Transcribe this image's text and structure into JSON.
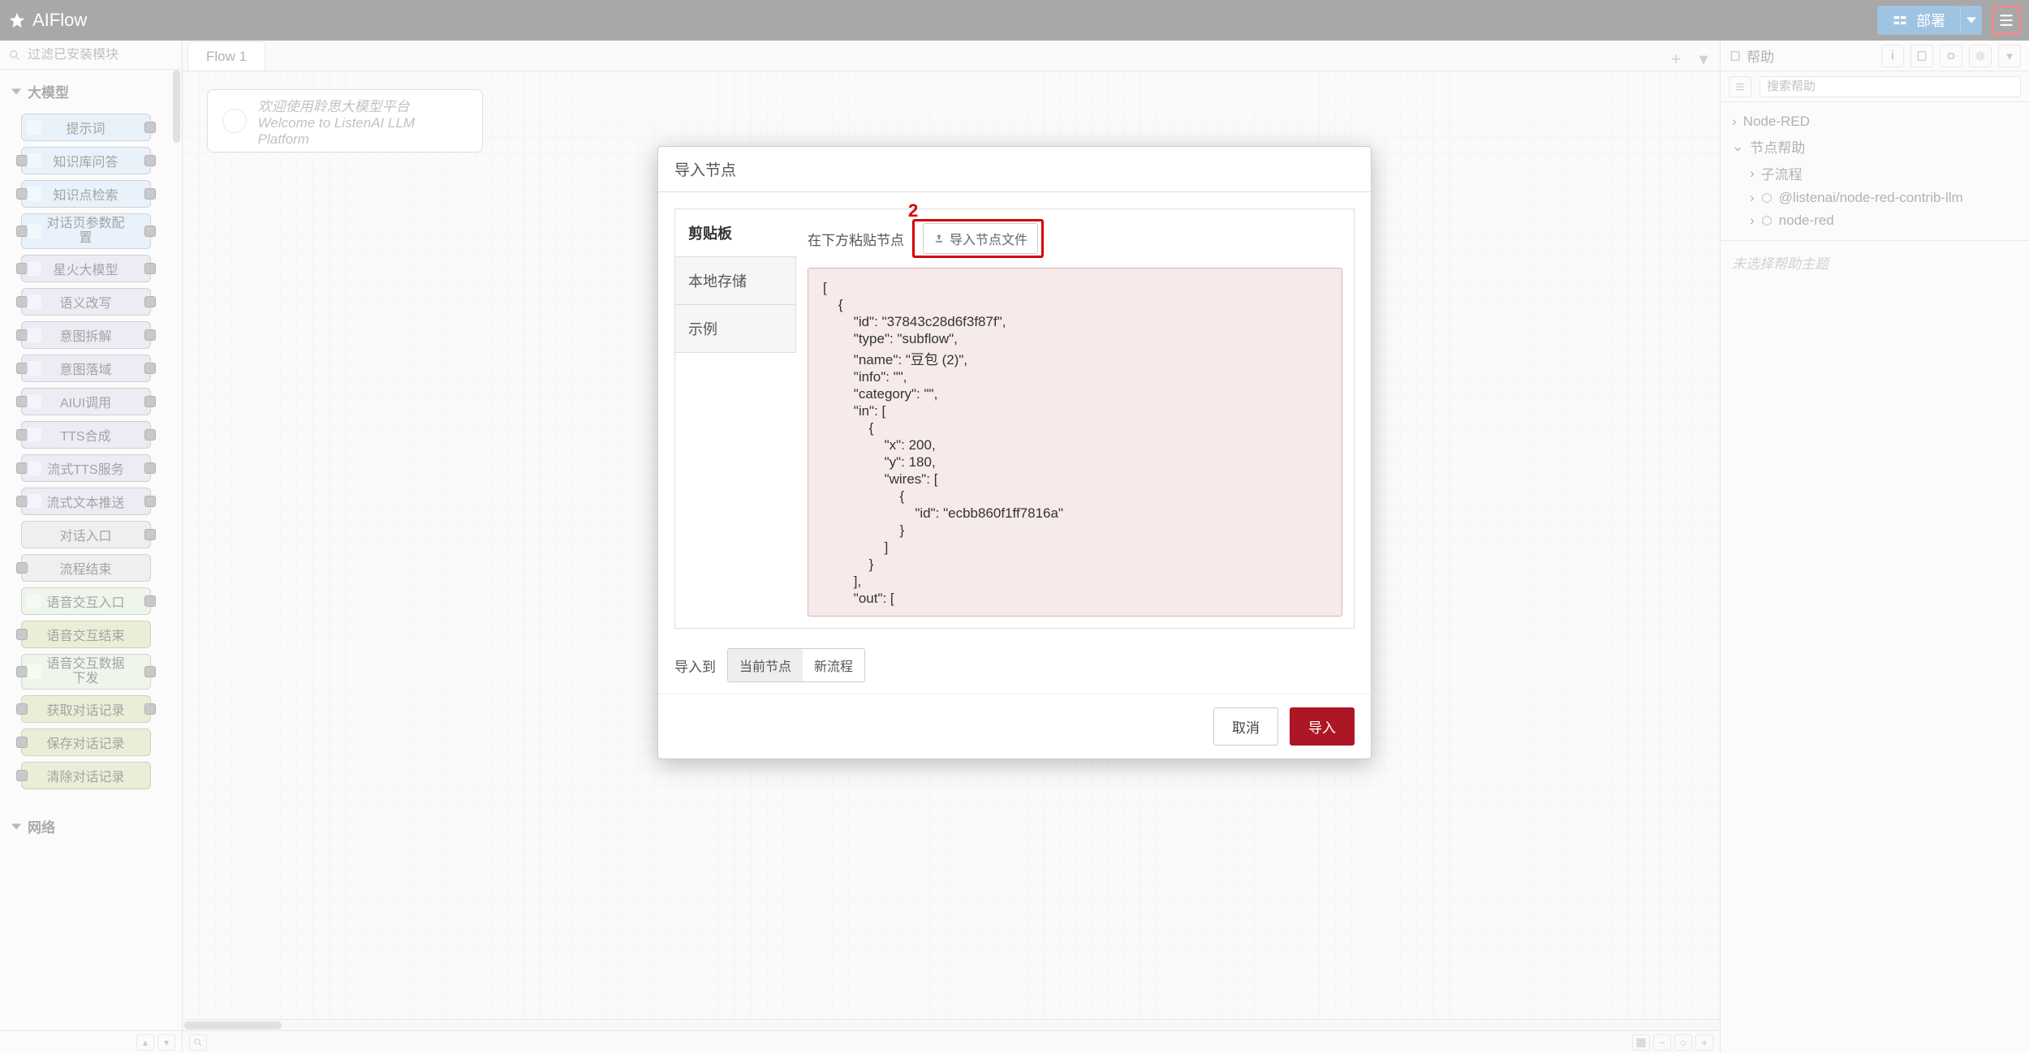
{
  "header": {
    "brand": "AIFlow",
    "deploy_label": "部署"
  },
  "palette": {
    "search_placeholder": "过滤已安装模块",
    "cat1": "大模型",
    "cat2": "网络",
    "nodes": {
      "n0": "提示词",
      "n1": "知识库问答",
      "n2": "知识点检索",
      "n3a": "对话页参数配",
      "n3b": "置",
      "n4": "星火大模型",
      "n5": "语义改写",
      "n6": "意图拆解",
      "n7": "意图落域",
      "n8": "AIUI调用",
      "n9": "TTS合成",
      "n10": "流式TTS服务",
      "n11": "流式文本推送",
      "n12": "对话入口",
      "n13": "流程结束",
      "n14": "语音交互入口",
      "n15": "语音交互结束",
      "n16a": "语音交互数据",
      "n16b": "下发",
      "n17": "获取对话记录",
      "n18": "保存对话记录",
      "n19": "清除对话记录"
    }
  },
  "workspace": {
    "tab1_label": "Flow 1",
    "welcome_line1": "欢迎使用聆思大模型平台",
    "welcome_line2": "Welcome to ListenAI LLM Platform"
  },
  "sidebar": {
    "title": "帮助",
    "search_placeholder": "搜索帮助",
    "tree": {
      "r1": "Node-RED",
      "r2": "节点帮助",
      "r3": "子流程",
      "r4": "@listenai/node-red-contrib-llm",
      "r5": "node-red"
    },
    "no_selection": "未选择帮助主题"
  },
  "dialog": {
    "title_label": "导入节点",
    "tab_clipboard": "剪贴板",
    "tab_local": "本地存储",
    "tab_example": "示例",
    "paste_label": "在下方粘贴节点",
    "file_button_label": "导入节点文件",
    "annotation_2": "2",
    "json_text": "[\n    {\n        \"id\": \"37843c28d6f3f87f\",\n        \"type\": \"subflow\",\n        \"name\": \"豆包 (2)\",\n        \"info\": \"\",\n        \"category\": \"\",\n        \"in\": [\n            {\n                \"x\": 200,\n                \"y\": 180,\n                \"wires\": [\n                    {\n                        \"id\": \"ecbb860f1ff7816a\"\n                    }\n                ]\n            }\n        ],\n        \"out\": [",
    "import_to_label": "导入到",
    "seg_current": "当前节点",
    "seg_new": "新流程",
    "cancel_label": "取消",
    "import_label": "导入"
  }
}
